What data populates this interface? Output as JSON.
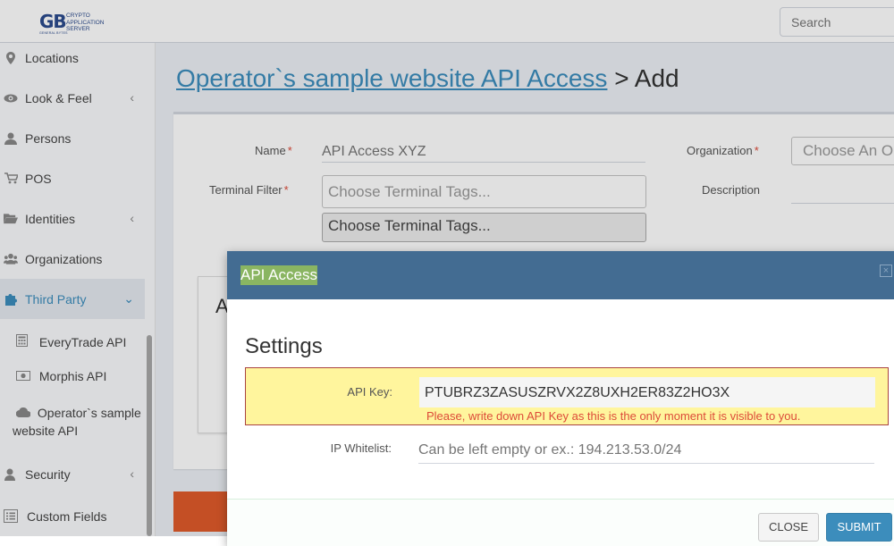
{
  "logo": {
    "big": "GB",
    "small_lines": [
      "CRYPTO",
      "APPLICATION",
      "SERVER"
    ],
    "sub": "GENERAL BYTES"
  },
  "search": {
    "placeholder": "Search"
  },
  "sidebar": {
    "items": [
      {
        "label": "Locations",
        "icon": "map-marker-icon"
      },
      {
        "label": "Look & Feel",
        "icon": "eye-icon",
        "has_children": true
      },
      {
        "label": "Persons",
        "icon": "person-icon"
      },
      {
        "label": "POS",
        "icon": "cart-icon"
      },
      {
        "label": "Identities",
        "icon": "folder-open-icon",
        "has_children": true
      },
      {
        "label": "Organizations",
        "icon": "group-icon"
      },
      {
        "label": "Third Party",
        "icon": "puzzle-icon",
        "active": true,
        "expanded": true
      },
      {
        "label": "Security",
        "icon": "user-lock-icon",
        "has_children": true
      },
      {
        "label": "Custom Fields",
        "icon": "list-icon"
      }
    ],
    "sub_items": [
      {
        "label": "EveryTrade API",
        "icon": "calculator-icon"
      },
      {
        "label": "Morphis API",
        "icon": "money-icon"
      },
      {
        "label": "Operator`s sample website API",
        "icon": "cloud-icon"
      }
    ]
  },
  "page": {
    "title_link": "Operator`s sample website API Access",
    "title_suffix": " > Add"
  },
  "form": {
    "name_label": "Name",
    "name_placeholder": "API Access XYZ",
    "terminal_filter_label": "Terminal Filter",
    "terminal_filter_placeholder": "Choose Terminal Tags...",
    "terminal_filter_dropdown": "Choose Terminal Tags...",
    "organization_label": "Organization",
    "organization_placeholder": "Choose An Or",
    "description_label": "Description",
    "required_mark": "*",
    "inner_box_letter": "A"
  },
  "modal": {
    "title": "API Access",
    "close_x": "×",
    "section": "Settings",
    "api_key_label": "API Key:",
    "api_key_value": "PTUBRZ3ZASUSZRVX2Z8UXH2ER83Z2HO3X",
    "api_key_help": "Please, write down API Key as this is the only moment it is visible to you.",
    "whitelist_label": "IP Whitelist:",
    "whitelist_placeholder": "Can be left empty or ex.: 194.213.53.0/24",
    "close_button": "CLOSE",
    "submit_button": "SUBMIT"
  },
  "colors": {
    "accent": "#3c8dbc",
    "modal_header": "#436c92",
    "warning_bg": "#fff59d",
    "error": "#dd4b39"
  }
}
